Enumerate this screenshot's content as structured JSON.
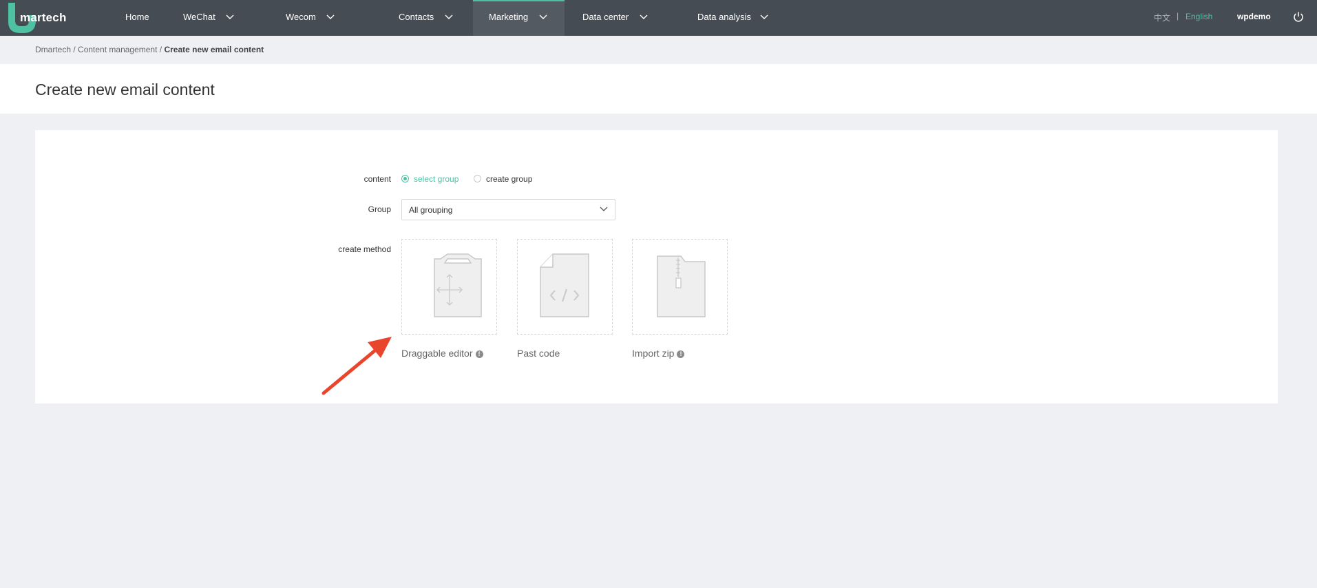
{
  "app": {
    "logo_text": "martech",
    "brand_color": "#4fc1a3",
    "nav_bg": "#464c54"
  },
  "nav": {
    "items": [
      {
        "label": "Home",
        "has_dropdown": false
      },
      {
        "label": "WeChat",
        "has_dropdown": true
      },
      {
        "label": "Wecom",
        "has_dropdown": true
      },
      {
        "label": "Contacts",
        "has_dropdown": true
      },
      {
        "label": "Marketing",
        "has_dropdown": true,
        "active": true
      },
      {
        "label": "Data center",
        "has_dropdown": true
      },
      {
        "label": "Data analysis",
        "has_dropdown": true
      }
    ],
    "lang_cn": "中文",
    "lang_sep": "|",
    "lang_en": "English",
    "user": "wpdemo",
    "logout_icon": "power-icon"
  },
  "breadcrumb": {
    "root": "Dmartech",
    "sep1": " / ",
    "section": "Content management",
    "sep2": " / ",
    "current": "Create new email content"
  },
  "page": {
    "title": "Create new email content"
  },
  "form": {
    "content_label": "content",
    "radio_options": [
      {
        "label": "select group",
        "checked": true
      },
      {
        "label": "create group",
        "checked": false
      }
    ],
    "group_label": "Group",
    "group_value": "All grouping",
    "method_label": "create method",
    "methods": [
      {
        "label": "Draggable editor",
        "icon": "draggable-editor-icon",
        "info": true
      },
      {
        "label": "Past code",
        "icon": "code-file-icon",
        "info": false
      },
      {
        "label": "Import zip",
        "icon": "zip-file-icon",
        "info": true
      }
    ],
    "info_glyph": "!"
  },
  "annotation": {
    "arrow_color": "#e8452c"
  }
}
